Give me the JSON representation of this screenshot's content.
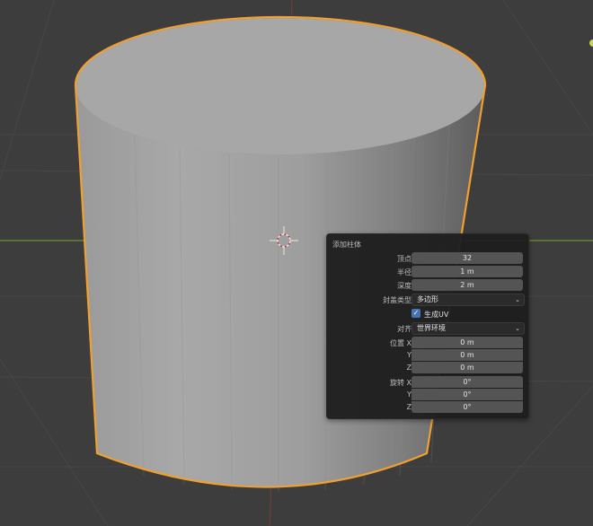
{
  "viewport": {
    "object": "cylinder",
    "colors": {
      "background": "#3d3d3d",
      "grid": "#4a4a4a",
      "x_axis": "#7a9a3a",
      "selection": "#f0a030"
    }
  },
  "panel": {
    "title": "添加柱体",
    "vertices": {
      "label": "顶点",
      "value": "32"
    },
    "radius": {
      "label": "半径",
      "value": "1 m"
    },
    "depth": {
      "label": "深度",
      "value": "2 m"
    },
    "cap_fill_type": {
      "label": "封盖类型",
      "value": "多边形"
    },
    "generate_uvs": {
      "label": "生成UV",
      "checked": true
    },
    "align": {
      "label": "对齐",
      "value": "世界环境"
    },
    "location": {
      "label": "位置",
      "x_label": "X",
      "y_label": "Y",
      "z_label": "Z",
      "x": "0 m",
      "y": "0 m",
      "z": "0 m"
    },
    "rotation": {
      "label": "旋转",
      "x_label": "X",
      "y_label": "Y",
      "z_label": "Z",
      "x": "0°",
      "y": "0°",
      "z": "0°"
    }
  }
}
